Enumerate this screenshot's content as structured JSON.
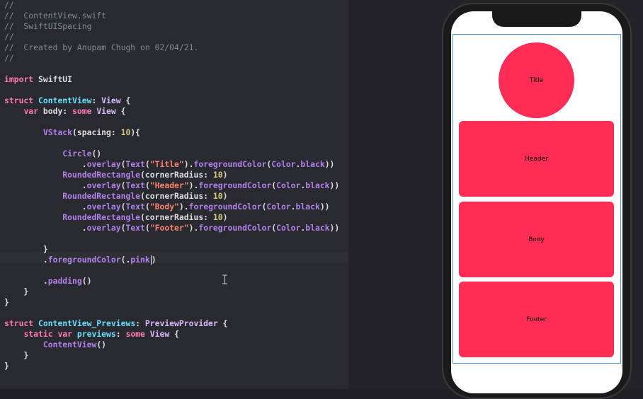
{
  "editor": {
    "lines": [
      [
        [
          "tk-comment",
          "//"
        ]
      ],
      [
        [
          "tk-comment",
          "//  ContentView.swift"
        ]
      ],
      [
        [
          "tk-comment",
          "//  SwiftUISpacing"
        ]
      ],
      [
        [
          "tk-comment",
          "//"
        ]
      ],
      [
        [
          "tk-comment",
          "//  Created by Anupam Chugh on 02/04/21."
        ]
      ],
      [
        [
          "tk-comment",
          "//"
        ]
      ],
      [],
      [
        [
          "tk-kw",
          "import"
        ],
        [
          "tk-plain",
          " SwiftUI"
        ]
      ],
      [],
      [
        [
          "tk-kw",
          "struct"
        ],
        [
          "tk-plain",
          " "
        ],
        [
          "tk-type",
          "ContentView"
        ],
        [
          "tk-plain",
          ": "
        ],
        [
          "tk-typeref",
          "View"
        ],
        [
          "tk-plain",
          " {"
        ]
      ],
      [
        [
          "tk-plain",
          "    "
        ],
        [
          "tk-kw",
          "var"
        ],
        [
          "tk-plain",
          " body: "
        ],
        [
          "tk-kw",
          "some"
        ],
        [
          "tk-plain",
          " "
        ],
        [
          "tk-typeref",
          "View"
        ],
        [
          "tk-plain",
          " {"
        ]
      ],
      [],
      [
        [
          "tk-plain",
          "        "
        ],
        [
          "tk-func",
          "VStack"
        ],
        [
          "tk-plain",
          "(spacing: "
        ],
        [
          "tk-num",
          "10"
        ],
        [
          "tk-plain",
          "){"
        ]
      ],
      [],
      [
        [
          "tk-plain",
          "            "
        ],
        [
          "tk-func",
          "Circle"
        ],
        [
          "tk-plain",
          "()"
        ]
      ],
      [
        [
          "tk-plain",
          "                ."
        ],
        [
          "tk-func",
          "overlay"
        ],
        [
          "tk-plain",
          "("
        ],
        [
          "tk-func",
          "Text"
        ],
        [
          "tk-plain",
          "("
        ],
        [
          "tk-str",
          "\"Title\""
        ],
        [
          "tk-plain",
          ")."
        ],
        [
          "tk-func",
          "foregroundColor"
        ],
        [
          "tk-plain",
          "("
        ],
        [
          "tk-func",
          "Color"
        ],
        [
          "tk-plain",
          "."
        ],
        [
          "tk-func",
          "black"
        ],
        [
          "tk-plain",
          "))"
        ]
      ],
      [
        [
          "tk-plain",
          "            "
        ],
        [
          "tk-func",
          "RoundedRectangle"
        ],
        [
          "tk-plain",
          "(cornerRadius: "
        ],
        [
          "tk-num",
          "10"
        ],
        [
          "tk-plain",
          ")"
        ]
      ],
      [
        [
          "tk-plain",
          "                ."
        ],
        [
          "tk-func",
          "overlay"
        ],
        [
          "tk-plain",
          "("
        ],
        [
          "tk-func",
          "Text"
        ],
        [
          "tk-plain",
          "("
        ],
        [
          "tk-str",
          "\"Header\""
        ],
        [
          "tk-plain",
          ")."
        ],
        [
          "tk-func",
          "foregroundColor"
        ],
        [
          "tk-plain",
          "("
        ],
        [
          "tk-func",
          "Color"
        ],
        [
          "tk-plain",
          "."
        ],
        [
          "tk-func",
          "black"
        ],
        [
          "tk-plain",
          "))"
        ]
      ],
      [
        [
          "tk-plain",
          "            "
        ],
        [
          "tk-func",
          "RoundedRectangle"
        ],
        [
          "tk-plain",
          "(cornerRadius: "
        ],
        [
          "tk-num",
          "10"
        ],
        [
          "tk-plain",
          ")"
        ]
      ],
      [
        [
          "tk-plain",
          "                ."
        ],
        [
          "tk-func",
          "overlay"
        ],
        [
          "tk-plain",
          "("
        ],
        [
          "tk-func",
          "Text"
        ],
        [
          "tk-plain",
          "("
        ],
        [
          "tk-str",
          "\"Body\""
        ],
        [
          "tk-plain",
          ")."
        ],
        [
          "tk-func",
          "foregroundColor"
        ],
        [
          "tk-plain",
          "("
        ],
        [
          "tk-func",
          "Color"
        ],
        [
          "tk-plain",
          "."
        ],
        [
          "tk-func",
          "black"
        ],
        [
          "tk-plain",
          "))"
        ]
      ],
      [
        [
          "tk-plain",
          "            "
        ],
        [
          "tk-func",
          "RoundedRectangle"
        ],
        [
          "tk-plain",
          "(cornerRadius: "
        ],
        [
          "tk-num",
          "10"
        ],
        [
          "tk-plain",
          ")"
        ]
      ],
      [
        [
          "tk-plain",
          "                ."
        ],
        [
          "tk-func",
          "overlay"
        ],
        [
          "tk-plain",
          "("
        ],
        [
          "tk-func",
          "Text"
        ],
        [
          "tk-plain",
          "("
        ],
        [
          "tk-str",
          "\"Footer\""
        ],
        [
          "tk-plain",
          ")."
        ],
        [
          "tk-func",
          "foregroundColor"
        ],
        [
          "tk-plain",
          "("
        ],
        [
          "tk-func",
          "Color"
        ],
        [
          "tk-plain",
          "."
        ],
        [
          "tk-func",
          "black"
        ],
        [
          "tk-plain",
          "))"
        ]
      ],
      [],
      [
        [
          "tk-plain",
          "        }"
        ]
      ],
      [
        [
          "tk-plain",
          "        ."
        ],
        [
          "tk-func",
          "foregroundColor"
        ],
        [
          "tk-plain",
          "(."
        ],
        [
          "tk-func",
          "pink"
        ],
        [
          "caret",
          ""
        ],
        [
          "tk-plain",
          ")"
        ]
      ],
      [],
      [
        [
          "tk-plain",
          "        ."
        ],
        [
          "tk-func",
          "padding"
        ],
        [
          "tk-plain",
          "()"
        ]
      ],
      [
        [
          "tk-plain",
          "    }"
        ]
      ],
      [
        [
          "tk-plain",
          "}"
        ]
      ],
      [],
      [
        [
          "tk-kw",
          "struct"
        ],
        [
          "tk-plain",
          " "
        ],
        [
          "tk-type",
          "ContentView_Previews"
        ],
        [
          "tk-plain",
          ": "
        ],
        [
          "tk-typeref",
          "PreviewProvider"
        ],
        [
          "tk-plain",
          " {"
        ]
      ],
      [
        [
          "tk-plain",
          "    "
        ],
        [
          "tk-kw",
          "static"
        ],
        [
          "tk-plain",
          " "
        ],
        [
          "tk-kw",
          "var"
        ],
        [
          "tk-plain",
          " "
        ],
        [
          "tk-type",
          "previews"
        ],
        [
          "tk-plain",
          ": "
        ],
        [
          "tk-kw",
          "some"
        ],
        [
          "tk-plain",
          " "
        ],
        [
          "tk-typeref",
          "View"
        ],
        [
          "tk-plain",
          " {"
        ]
      ],
      [
        [
          "tk-plain",
          "        "
        ],
        [
          "tk-func",
          "ContentView"
        ],
        [
          "tk-plain",
          "()"
        ]
      ],
      [
        [
          "tk-plain",
          "    }"
        ]
      ],
      [
        [
          "tk-plain",
          "}"
        ]
      ]
    ]
  },
  "preview": {
    "items": [
      {
        "shape": "circle",
        "label": "Title"
      },
      {
        "shape": "rounded-rect",
        "label": "Header"
      },
      {
        "shape": "rounded-rect",
        "label": "Body"
      },
      {
        "shape": "rounded-rect",
        "label": "Footer"
      }
    ]
  },
  "colors": {
    "editor_background": "#292a30",
    "canvas_background": "#242428",
    "preview_fill": "#ff2d55"
  },
  "icons": {
    "text_cursor": "ibeam-cursor-icon"
  }
}
